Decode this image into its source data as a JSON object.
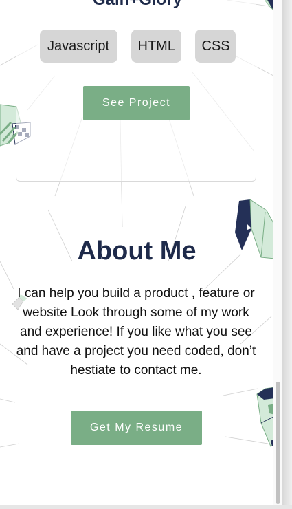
{
  "project": {
    "title": "Gain+Glory",
    "tags": [
      "Javascript",
      "HTML",
      "CSS"
    ],
    "button_label": "See Project"
  },
  "about": {
    "title": "About Me",
    "text": "I can help you build a product , feature or website Look through some of my work and experience! If you like what you see and have a project you need coded, don’t hestiate to contact me.",
    "button_label": "Get My Resume"
  },
  "colors": {
    "accent": "#7aae86",
    "heading": "#1e2a4a",
    "tag_bg": "#d6d6d6",
    "gem_dark": "#243057",
    "gem_light": "#d3ead9"
  }
}
